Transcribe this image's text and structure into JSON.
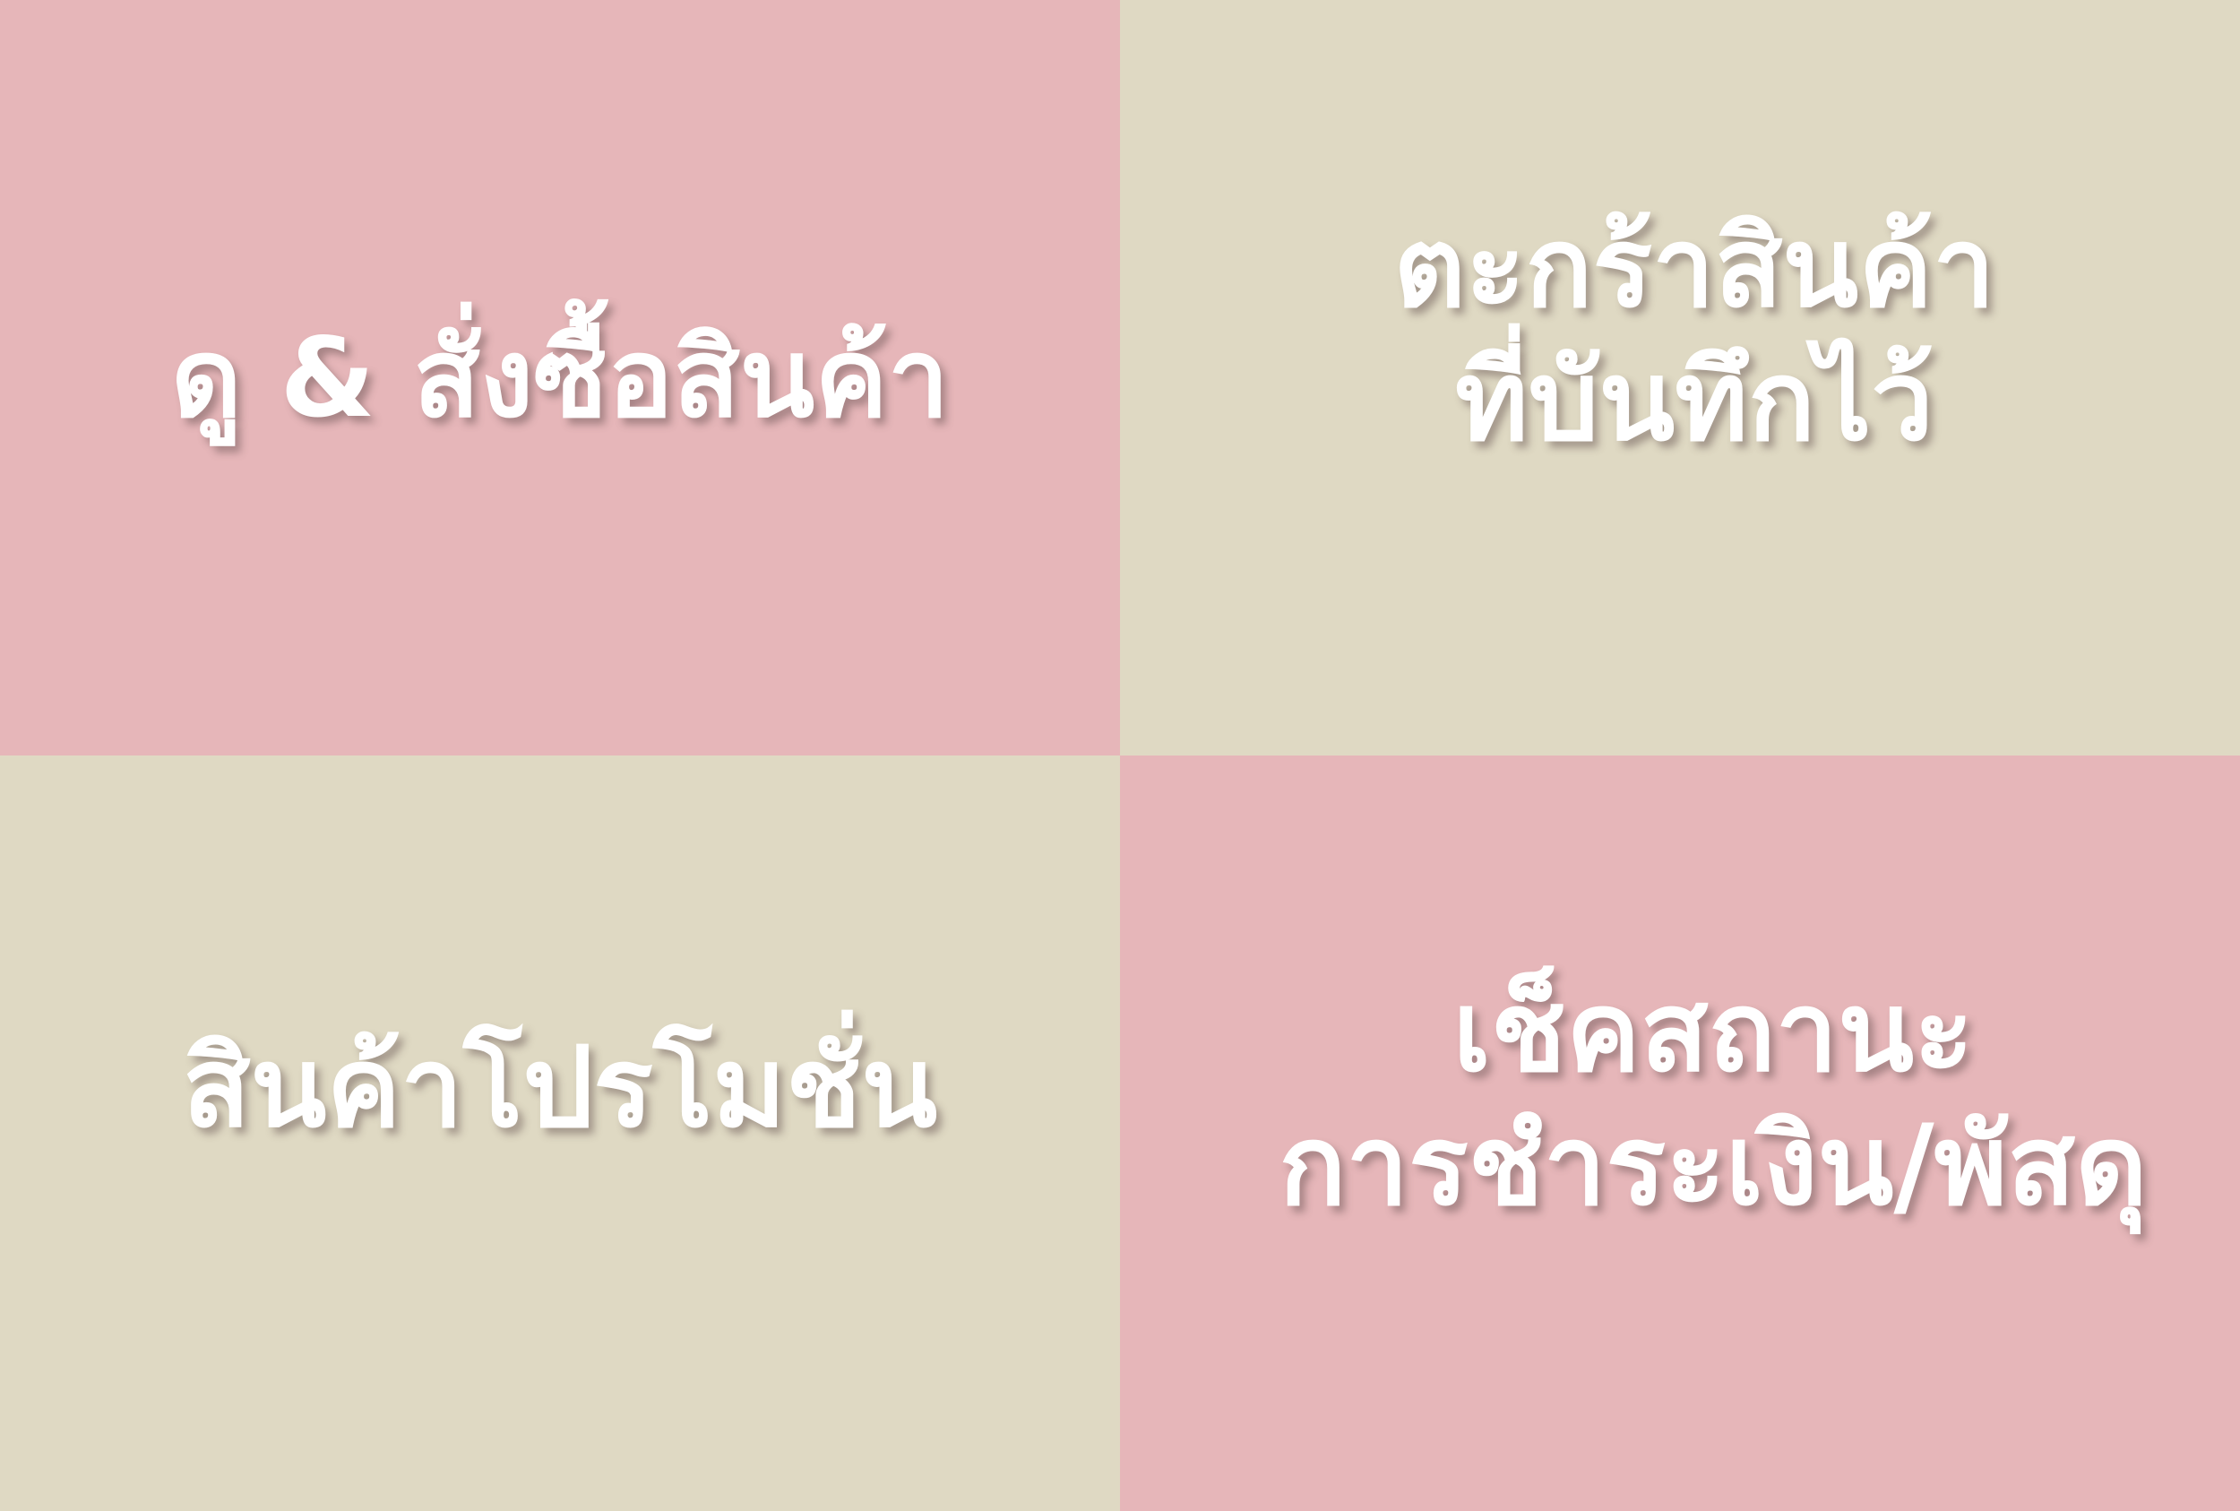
{
  "colors": {
    "pink": "#e6b6b9",
    "beige": "#dfd9c3",
    "text": "#ffffff"
  },
  "menu": {
    "tiles": [
      {
        "lines": [
          "ดู & สั่งซื้อสินค้า"
        ],
        "bg": "#e6b6b9"
      },
      {
        "lines": [
          "ตะกร้าสินค้า",
          "ที่บันทึกไว้"
        ],
        "bg": "#dfd9c3"
      },
      {
        "lines": [
          "สินค้าโปรโมชั่น"
        ],
        "bg": "#dfd9c3"
      },
      {
        "lines": [
          "เช็คสถานะ",
          "การชำระเงิน/พัสดุ"
        ],
        "bg": "#e6b6b9"
      }
    ]
  }
}
